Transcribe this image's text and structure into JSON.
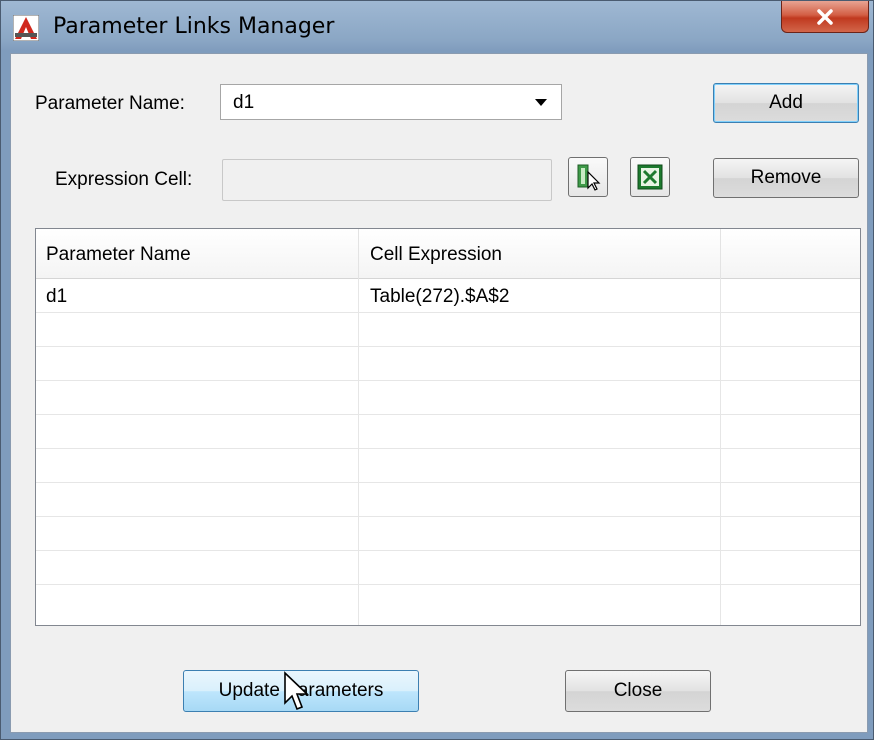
{
  "window": {
    "title": "Parameter Links Manager",
    "close_glyph": "x"
  },
  "form": {
    "parameter_name_label": "Parameter Name:",
    "parameter_name_value": "d1",
    "expression_cell_label": "Expression Cell:",
    "expression_cell_value": ""
  },
  "buttons": {
    "add": "Add",
    "remove": "Remove",
    "update": "Update Parameters",
    "close": "Close"
  },
  "table": {
    "columns": [
      "Parameter Name",
      "Cell Expression",
      ""
    ],
    "rows": [
      [
        "d1",
        "Table(272).$A$2",
        ""
      ],
      [
        "",
        "",
        ""
      ],
      [
        "",
        "",
        ""
      ],
      [
        "",
        "",
        ""
      ],
      [
        "",
        "",
        ""
      ],
      [
        "",
        "",
        ""
      ],
      [
        "",
        "",
        ""
      ],
      [
        "",
        "",
        ""
      ],
      [
        "",
        "",
        ""
      ],
      [
        "",
        "",
        ""
      ]
    ]
  },
  "icons": {
    "app": "autocad-app-icon",
    "pick": "pick-cell-icon",
    "excel": "excel-icon"
  },
  "colors": {
    "excel_green": "#1d7a2e",
    "close_red": "#c0391f"
  }
}
